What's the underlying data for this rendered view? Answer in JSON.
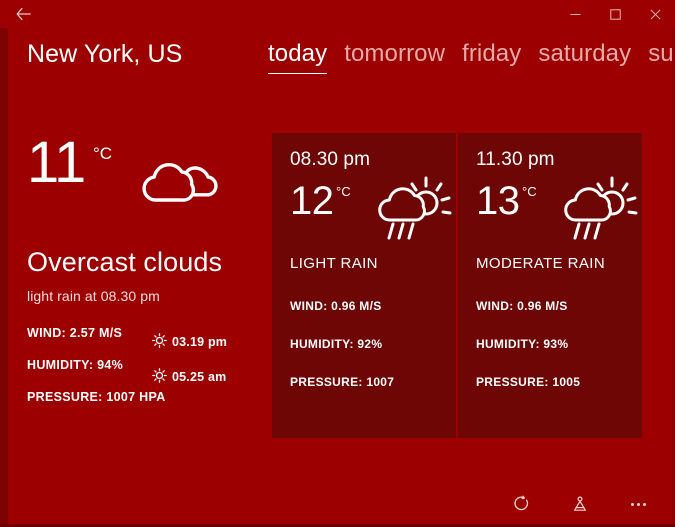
{
  "window": {
    "back_label": "back-arrow",
    "minimize_label": "Minimize",
    "maximize_label": "Maximize",
    "close_label": "Close",
    "bg_color": "#9c0000",
    "card_color": "#6f0606",
    "accent_text": "#ffffff",
    "muted_text": "#e8a9a9"
  },
  "header": {
    "city": "New York, US",
    "tabs": [
      {
        "label": "today",
        "active": true
      },
      {
        "label": "tomorrow",
        "active": false
      },
      {
        "label": "friday",
        "active": false
      },
      {
        "label": "saturday",
        "active": false
      },
      {
        "label": "sun",
        "active": false
      }
    ]
  },
  "current": {
    "temperature": "11",
    "unit": "°C",
    "icon": "overcast-clouds-icon",
    "condition": "Overcast clouds",
    "subtitle": "light rain at 08.30 pm",
    "wind": "WIND: 2.57 M/S",
    "humidity": "HUMIDITY: 94%",
    "pressure": "PRESSURE: 1007 HPA",
    "sunset": "03.19 pm",
    "sunrise": "05.25 am"
  },
  "forecast": [
    {
      "time": "08.30 pm",
      "temperature": "12",
      "unit": "°C",
      "icon": "sun-cloud-rain-icon",
      "condition": "LIGHT RAIN",
      "wind": "WIND: 0.96 M/S",
      "humidity": "HUMIDITY: 92%",
      "pressure": "PRESSURE: 1007"
    },
    {
      "time": "11.30 pm",
      "temperature": "13",
      "unit": "°C",
      "icon": "sun-cloud-rain-icon",
      "condition": "MODERATE RAIN",
      "wind": "WIND: 0.96 M/S",
      "humidity": "HUMIDITY: 93%",
      "pressure": "PRESSURE: 1005"
    }
  ],
  "appbar": {
    "refresh_label": "refresh-icon",
    "location_label": "location-icon",
    "more_label": "more-icon"
  }
}
